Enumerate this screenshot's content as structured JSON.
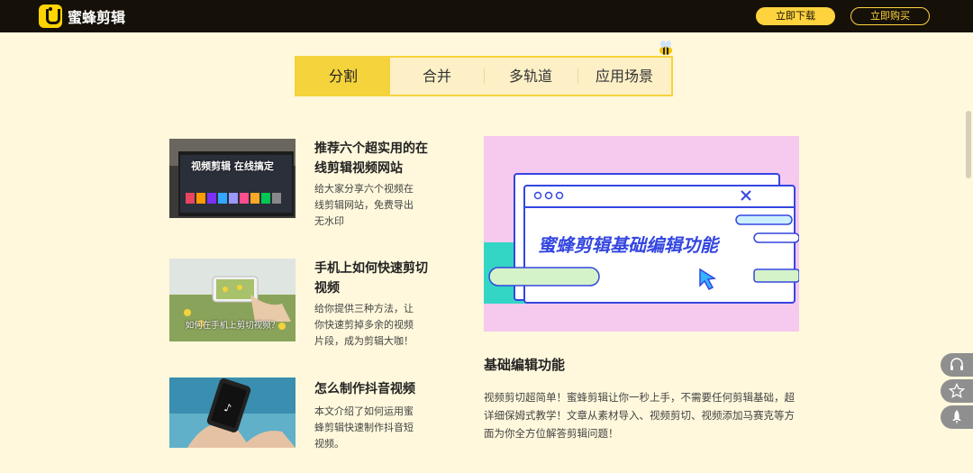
{
  "header": {
    "brand": "蜜蜂剪辑",
    "download_label": "立即下载",
    "buy_label": "立即购买"
  },
  "tabs": [
    {
      "label": "分割",
      "active": true
    },
    {
      "label": "合并",
      "active": false
    },
    {
      "label": "多轨道",
      "active": false
    },
    {
      "label": "应用场景",
      "active": false
    }
  ],
  "articles": [
    {
      "title": "推荐六个超实用的在线剪辑视频网站",
      "desc": "给大家分享六个视频在线剪辑网站，免费导出无水印",
      "thumb_caption": "视频剪辑 在线搞定"
    },
    {
      "title": "手机上如何快速剪切视频",
      "desc": "给你提供三种方法，让你快速剪掉多余的视频片段，成为剪辑大咖！",
      "thumb_caption": "如何在手机上剪切视频？"
    },
    {
      "title": "怎么制作抖音视频",
      "desc": "本文介绍了如何运用蜜蜂剪辑快速制作抖音短视频。",
      "thumb_caption": ""
    }
  ],
  "feature": {
    "banner_text": "蜜蜂剪辑基础编辑功能",
    "title": "基础编辑功能",
    "desc": "视频剪切超简单！蜜蜂剪辑让你一秒上手，不需要任何剪辑基础，超详细保姆式教学！文章从素材导入、视频剪切、视频添加马赛克等方面为你全方位解答剪辑问题！"
  },
  "float_icons": [
    "headset-icon",
    "star-icon",
    "rocket-icon"
  ],
  "colors": {
    "accent": "#f5d33c",
    "page_bg": "#fff8dc",
    "topbar": "#151108",
    "banner_bg": "#f6c9ee"
  }
}
